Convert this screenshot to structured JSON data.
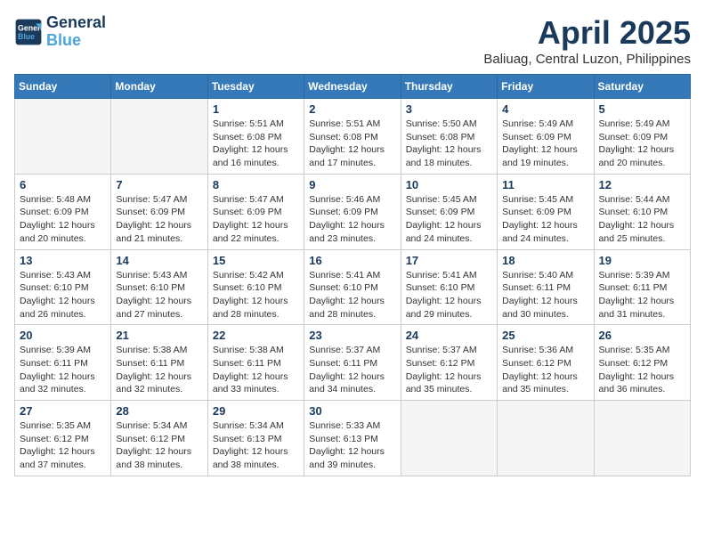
{
  "header": {
    "logo_line1": "General",
    "logo_line2": "Blue",
    "title": "April 2025",
    "subtitle": "Baliuag, Central Luzon, Philippines"
  },
  "columns": [
    "Sunday",
    "Monday",
    "Tuesday",
    "Wednesday",
    "Thursday",
    "Friday",
    "Saturday"
  ],
  "weeks": [
    [
      {
        "day": "",
        "detail": ""
      },
      {
        "day": "",
        "detail": ""
      },
      {
        "day": "1",
        "detail": "Sunrise: 5:51 AM\nSunset: 6:08 PM\nDaylight: 12 hours\nand 16 minutes."
      },
      {
        "day": "2",
        "detail": "Sunrise: 5:51 AM\nSunset: 6:08 PM\nDaylight: 12 hours\nand 17 minutes."
      },
      {
        "day": "3",
        "detail": "Sunrise: 5:50 AM\nSunset: 6:08 PM\nDaylight: 12 hours\nand 18 minutes."
      },
      {
        "day": "4",
        "detail": "Sunrise: 5:49 AM\nSunset: 6:09 PM\nDaylight: 12 hours\nand 19 minutes."
      },
      {
        "day": "5",
        "detail": "Sunrise: 5:49 AM\nSunset: 6:09 PM\nDaylight: 12 hours\nand 20 minutes."
      }
    ],
    [
      {
        "day": "6",
        "detail": "Sunrise: 5:48 AM\nSunset: 6:09 PM\nDaylight: 12 hours\nand 20 minutes."
      },
      {
        "day": "7",
        "detail": "Sunrise: 5:47 AM\nSunset: 6:09 PM\nDaylight: 12 hours\nand 21 minutes."
      },
      {
        "day": "8",
        "detail": "Sunrise: 5:47 AM\nSunset: 6:09 PM\nDaylight: 12 hours\nand 22 minutes."
      },
      {
        "day": "9",
        "detail": "Sunrise: 5:46 AM\nSunset: 6:09 PM\nDaylight: 12 hours\nand 23 minutes."
      },
      {
        "day": "10",
        "detail": "Sunrise: 5:45 AM\nSunset: 6:09 PM\nDaylight: 12 hours\nand 24 minutes."
      },
      {
        "day": "11",
        "detail": "Sunrise: 5:45 AM\nSunset: 6:09 PM\nDaylight: 12 hours\nand 24 minutes."
      },
      {
        "day": "12",
        "detail": "Sunrise: 5:44 AM\nSunset: 6:10 PM\nDaylight: 12 hours\nand 25 minutes."
      }
    ],
    [
      {
        "day": "13",
        "detail": "Sunrise: 5:43 AM\nSunset: 6:10 PM\nDaylight: 12 hours\nand 26 minutes."
      },
      {
        "day": "14",
        "detail": "Sunrise: 5:43 AM\nSunset: 6:10 PM\nDaylight: 12 hours\nand 27 minutes."
      },
      {
        "day": "15",
        "detail": "Sunrise: 5:42 AM\nSunset: 6:10 PM\nDaylight: 12 hours\nand 28 minutes."
      },
      {
        "day": "16",
        "detail": "Sunrise: 5:41 AM\nSunset: 6:10 PM\nDaylight: 12 hours\nand 28 minutes."
      },
      {
        "day": "17",
        "detail": "Sunrise: 5:41 AM\nSunset: 6:10 PM\nDaylight: 12 hours\nand 29 minutes."
      },
      {
        "day": "18",
        "detail": "Sunrise: 5:40 AM\nSunset: 6:11 PM\nDaylight: 12 hours\nand 30 minutes."
      },
      {
        "day": "19",
        "detail": "Sunrise: 5:39 AM\nSunset: 6:11 PM\nDaylight: 12 hours\nand 31 minutes."
      }
    ],
    [
      {
        "day": "20",
        "detail": "Sunrise: 5:39 AM\nSunset: 6:11 PM\nDaylight: 12 hours\nand 32 minutes."
      },
      {
        "day": "21",
        "detail": "Sunrise: 5:38 AM\nSunset: 6:11 PM\nDaylight: 12 hours\nand 32 minutes."
      },
      {
        "day": "22",
        "detail": "Sunrise: 5:38 AM\nSunset: 6:11 PM\nDaylight: 12 hours\nand 33 minutes."
      },
      {
        "day": "23",
        "detail": "Sunrise: 5:37 AM\nSunset: 6:11 PM\nDaylight: 12 hours\nand 34 minutes."
      },
      {
        "day": "24",
        "detail": "Sunrise: 5:37 AM\nSunset: 6:12 PM\nDaylight: 12 hours\nand 35 minutes."
      },
      {
        "day": "25",
        "detail": "Sunrise: 5:36 AM\nSunset: 6:12 PM\nDaylight: 12 hours\nand 35 minutes."
      },
      {
        "day": "26",
        "detail": "Sunrise: 5:35 AM\nSunset: 6:12 PM\nDaylight: 12 hours\nand 36 minutes."
      }
    ],
    [
      {
        "day": "27",
        "detail": "Sunrise: 5:35 AM\nSunset: 6:12 PM\nDaylight: 12 hours\nand 37 minutes."
      },
      {
        "day": "28",
        "detail": "Sunrise: 5:34 AM\nSunset: 6:12 PM\nDaylight: 12 hours\nand 38 minutes."
      },
      {
        "day": "29",
        "detail": "Sunrise: 5:34 AM\nSunset: 6:13 PM\nDaylight: 12 hours\nand 38 minutes."
      },
      {
        "day": "30",
        "detail": "Sunrise: 5:33 AM\nSunset: 6:13 PM\nDaylight: 12 hours\nand 39 minutes."
      },
      {
        "day": "",
        "detail": ""
      },
      {
        "day": "",
        "detail": ""
      },
      {
        "day": "",
        "detail": ""
      }
    ]
  ]
}
